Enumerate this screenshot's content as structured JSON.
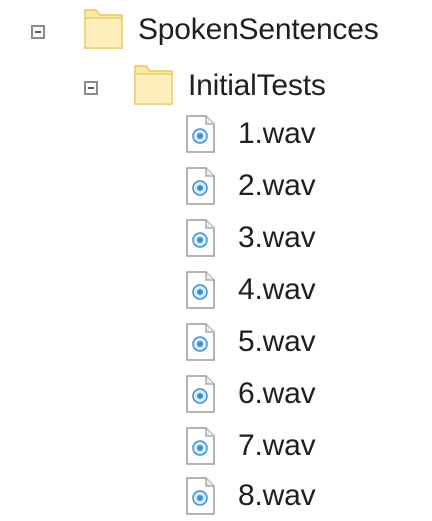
{
  "tree": {
    "root": {
      "label": "SpokenSentences",
      "icon": "folder-icon",
      "expanded": true,
      "children": {
        "folder": {
          "label": "InitialTests",
          "icon": "folder-icon",
          "expanded": true,
          "files": [
            {
              "label": "1.wav",
              "icon": "audio-file-icon"
            },
            {
              "label": "2.wav",
              "icon": "audio-file-icon"
            },
            {
              "label": "3.wav",
              "icon": "audio-file-icon"
            },
            {
              "label": "4.wav",
              "icon": "audio-file-icon"
            },
            {
              "label": "5.wav",
              "icon": "audio-file-icon"
            },
            {
              "label": "6.wav",
              "icon": "audio-file-icon"
            },
            {
              "label": "7.wav",
              "icon": "audio-file-icon"
            },
            {
              "label": "8.wav",
              "icon": "audio-file-icon"
            }
          ]
        }
      }
    }
  },
  "colors": {
    "folder_fill": "#fbe9a6",
    "folder_edge": "#e9c663",
    "file_accent": "#3d8fd8",
    "text": "#1f1f1f"
  }
}
